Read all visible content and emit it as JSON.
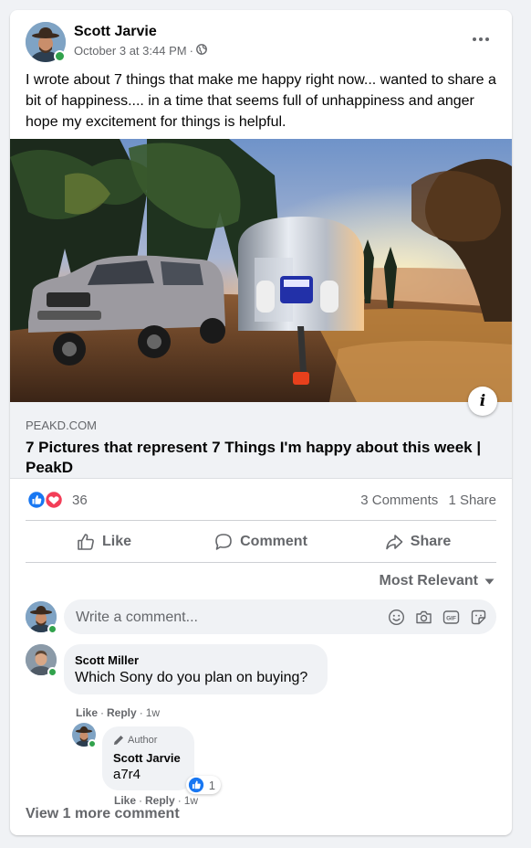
{
  "post": {
    "author": "Scott Jarvie",
    "timestamp": "October 3 at 3:44 PM",
    "separator": "·",
    "audience_icon": "globe-icon",
    "more_icon": "more-horizontal-icon",
    "text": "I wrote about 7 things that make me happy right now... wanted to share a bit of happiness.... in a time that seems full of unhappiness and anger hope my excitement for things is helpful.",
    "link": {
      "domain": "PEAKD.COM",
      "title": "7 Pictures that represent 7 Things I'm happy about this week | PeakD",
      "info_label": "i"
    }
  },
  "stats": {
    "reaction_icons": [
      "like-icon",
      "love-icon"
    ],
    "reaction_count": "36",
    "comments": "3 Comments",
    "shares": "1 Share"
  },
  "actions": {
    "like": "Like",
    "comment": "Comment",
    "share": "Share"
  },
  "sort": {
    "label": "Most Relevant"
  },
  "composer": {
    "placeholder": "Write a comment...",
    "icons": [
      "emoji-icon",
      "camera-icon",
      "gif-icon",
      "sticker-icon"
    ]
  },
  "comments": [
    {
      "author": "Scott Miller",
      "text": "Which Sony do you plan on buying?",
      "like": "Like",
      "reply": "Reply",
      "sep": "·",
      "time": "1w"
    }
  ],
  "replies": [
    {
      "badge": "Author",
      "author": "Scott Jarvie",
      "text": "a7r4",
      "reaction_count": "1",
      "like": "Like",
      "reply": "Reply",
      "sep": "·",
      "time": "1w"
    }
  ],
  "view_more": "View 1 more comment",
  "colors": {
    "brand_blue": "#1877f2",
    "love_red": "#f33e58",
    "online_green": "#31a24c",
    "secondary_text": "#65676b"
  }
}
